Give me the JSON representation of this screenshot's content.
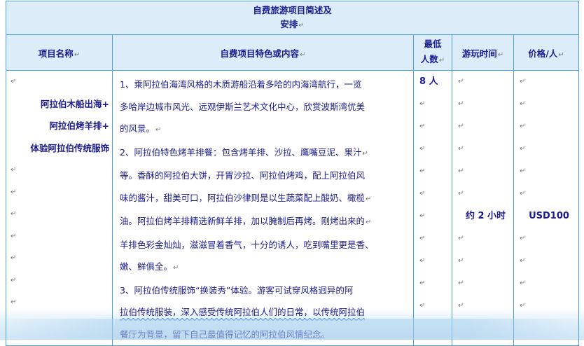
{
  "table": {
    "title_line1": "自费旅游项目简述及",
    "title_line2": "安排",
    "mark": "↵",
    "headers": {
      "name": "项目名称",
      "content": "自费项目特色或内容",
      "min_people_line1": "最低",
      "min_people_line2": "人数",
      "duration": "游玩时间",
      "price": "价格/人"
    },
    "row": {
      "name_lines": [
        "阿拉伯木船出海+",
        "阿拉伯烤羊排+",
        "体验阿拉伯传统服饰"
      ],
      "content_lines": [
        "1、乘阿拉伯海湾风格的木质游船沿着多哈的内海湾航行，一览",
        "多哈岸边城市风光、远观伊斯兰艺术文化中心，欣赏波斯湾优美",
        "的风景。",
        "2、阿拉伯特色烤羊排餐：包含烤羊排、沙拉、鹰嘴豆泥、果汁",
        "等。香酥的阿拉伯大饼，开胃沙拉、阿拉伯烤鸡，配上阿拉伯风",
        "味的酱汁，甜美可口，阿拉伯沙律则是以生蔬菜配上酸奶、橄榄",
        "油。阿拉伯烤羊排精选新鲜羊排，加以腌制后再烤。刚烤出来的",
        "羊排色彩金灿灿，滋滋冒着香气，十分的诱人，吃到嘴里更是香、",
        "嫩、鲜俱全。",
        "3、阿拉伯传统服饰“换装秀”体验。游客可试穿风格迥异的阿",
        "拉伯传统服装，深入感受传统阿拉伯人们的日常，以传统阿拉伯",
        "餐厅为背景，留下自己最值得记忆的阿拉伯风情纪念。"
      ],
      "min_people": "8 人",
      "duration": "约 2 小时",
      "price": "USD100"
    }
  }
}
